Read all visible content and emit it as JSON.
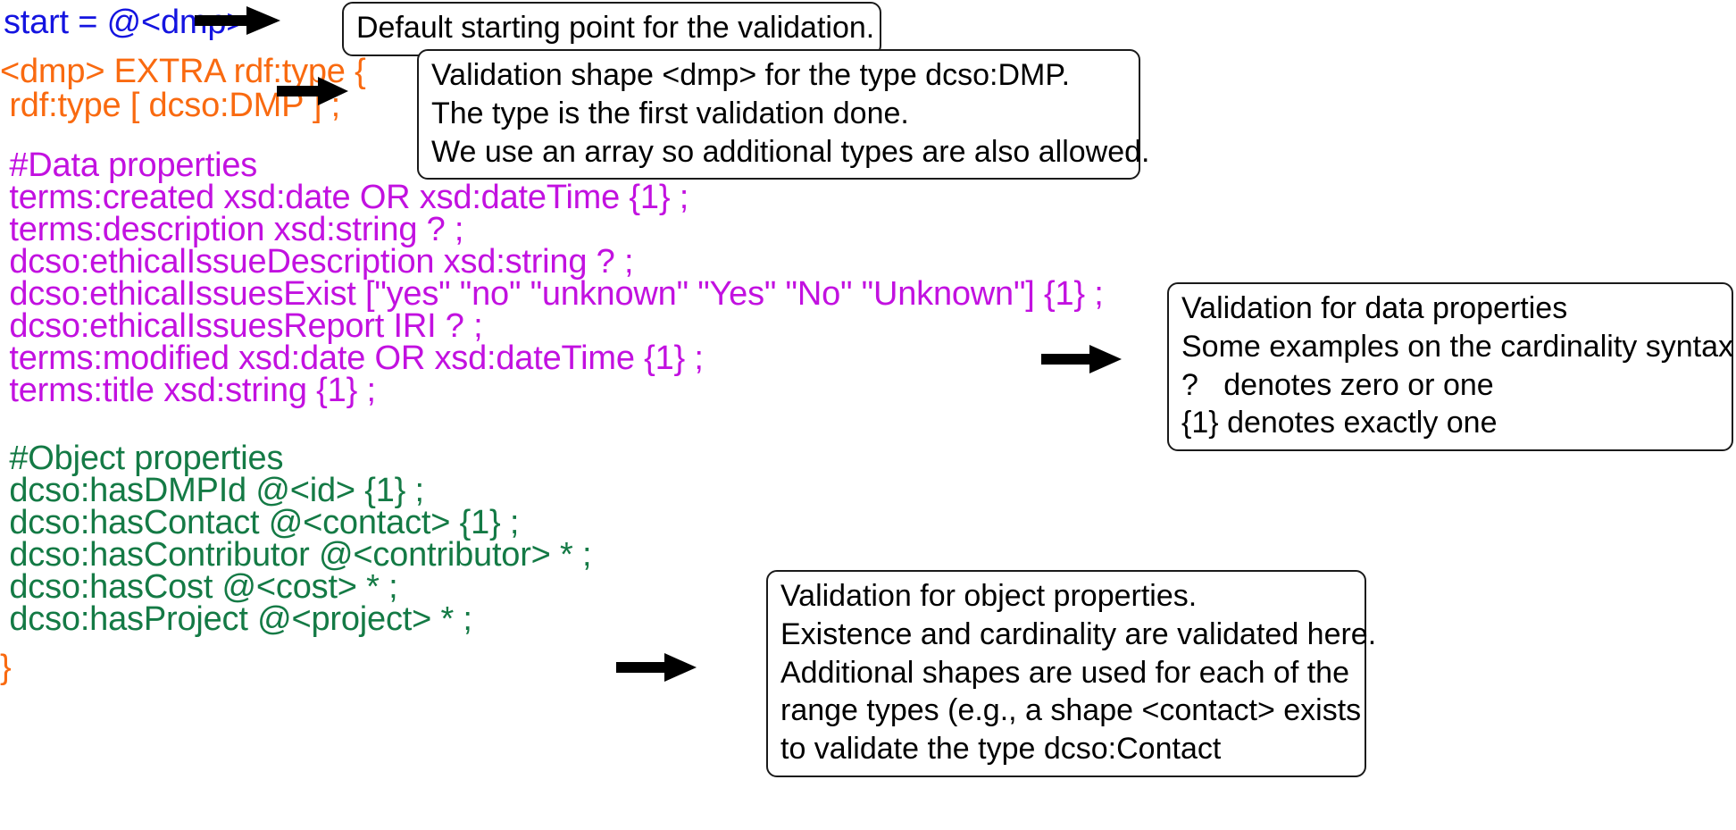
{
  "figure": {
    "kind": "annotated-code-figure",
    "colors": {
      "blue": "#1414e0",
      "orange": "#f96a10",
      "purple": "#c211e0",
      "green": "#147a45",
      "callout_border": "#1a1a1a",
      "background": "#ffffff"
    }
  },
  "code": {
    "lines": [
      {
        "text": "start = @<dmp>",
        "color": "blue"
      },
      {
        "text": "<dmp> EXTRA rdf:type {",
        "color": "orange"
      },
      {
        "text": " rdf:type [ dcso:DMP ] ;",
        "color": "orange"
      },
      {
        "text": " #Data properties",
        "color": "purple"
      },
      {
        "text": " terms:created xsd:date OR xsd:dateTime {1} ;",
        "color": "purple"
      },
      {
        "text": " terms:description xsd:string ? ;",
        "color": "purple"
      },
      {
        "text": " dcso:ethicalIssueDescription xsd:string ? ;",
        "color": "purple"
      },
      {
        "text": " dcso:ethicalIssuesExist [\"yes\" \"no\" \"unknown\" \"Yes\" \"No\" \"Unknown\"] {1} ;",
        "color": "purple"
      },
      {
        "text": " dcso:ethicalIssuesReport IRI ? ;",
        "color": "purple"
      },
      {
        "text": " terms:modified xsd:date OR xsd:dateTime {1} ;",
        "color": "purple"
      },
      {
        "text": " terms:title xsd:string {1} ;",
        "color": "purple"
      },
      {
        "text": " #Object properties",
        "color": "green"
      },
      {
        "text": " dcso:hasDMPId @<id> {1} ;",
        "color": "green"
      },
      {
        "text": " dcso:hasContact @<contact> {1} ;",
        "color": "green"
      },
      {
        "text": " dcso:hasContributor @<contributor> * ;",
        "color": "green"
      },
      {
        "text": " dcso:hasCost @<cost> * ;",
        "color": "green"
      },
      {
        "text": " dcso:hasProject @<project> * ;",
        "color": "green"
      },
      {
        "text": "}",
        "color": "orange"
      }
    ]
  },
  "callouts": {
    "start": {
      "lines": [
        "Default starting point for the validation."
      ]
    },
    "shape": {
      "lines": [
        "Validation shape <dmp> for the type dcso:DMP.",
        "The type is the first validation done.",
        "We use an array so additional types are also allowed."
      ]
    },
    "data_properties": {
      "lines": [
        "Validation for data properties",
        "Some examples on the cardinality syntax:",
        "?   denotes zero or one",
        "{1} denotes exactly one"
      ]
    },
    "object_properties": {
      "lines": [
        "Validation for object properties.",
        "Existence and cardinality are validated here.",
        "Additional shapes are used for each of the",
        "range types (e.g., a shape <contact> exists",
        "to validate the type dcso:Contact"
      ]
    }
  },
  "arrows": {
    "start_arrow": {
      "label": "arrow pointing to start callout"
    },
    "shape_arrow": {
      "label": "arrow pointing to shape callout"
    },
    "data_arrow": {
      "label": "arrow pointing to data properties callout"
    },
    "object_arrow": {
      "label": "arrow pointing to object properties callout"
    }
  }
}
